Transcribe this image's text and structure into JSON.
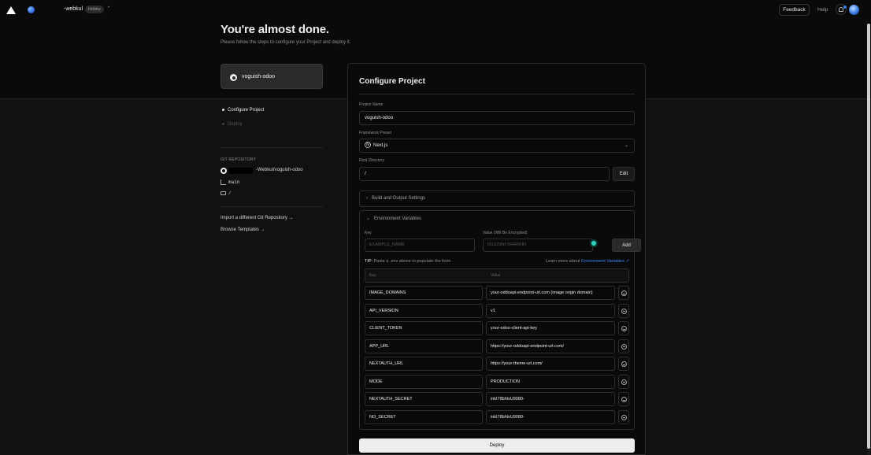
{
  "nav": {
    "team_name": "-webkul",
    "team_plan": "Hobby",
    "feedback_label": "Feedback",
    "help_label": "Help"
  },
  "hero": {
    "title": "You're almost done.",
    "subtitle": "Please follow the steps to configure your Project and deploy it.",
    "repo_card": "voguish-odoo"
  },
  "steps": [
    {
      "label": "Configure Project",
      "active": true
    },
    {
      "label": "Deploy",
      "active": false
    }
  ],
  "git": {
    "section_label": "GIT REPOSITORY",
    "repo": "-Webkul/voguish-odoo",
    "branch": "main",
    "directory": "/"
  },
  "links": {
    "import_repo": "Import a different Git Repository →",
    "browse_templates": "Browse Templates →"
  },
  "configure": {
    "title": "Configure Project",
    "project_name_label": "Project Name",
    "project_name_value": "voguish-odoo",
    "framework_label": "Framework Preset",
    "framework_value": "Next.js",
    "framework_icon": "N",
    "root_dir_label": "Root Directory",
    "root_dir_value": "/",
    "edit_label": "Edit",
    "build_settings_label": "Build and Output Settings",
    "env_section_label": "Environment Variables",
    "key_label": "Key",
    "value_label": "Value (Will Be Encrypted)",
    "key_placeholder": "EXAMPLE_NAME",
    "value_placeholder": "I9JU23NF394R6HH",
    "add_label": "Add",
    "tip_prefix": "TIP:",
    "tip_text": "Paste a .env above to populate the form",
    "learn_more_text": "Learn more about",
    "learn_more_link": "Environment Variables ↗",
    "table_key_header": "Key",
    "table_value_header": "Value",
    "env_vars": [
      {
        "key": "IMAGE_DOMAINS",
        "value": "your-oddoapi-endpoint-url.com (image origin domain)"
      },
      {
        "key": "API_VERSION",
        "value": "v1"
      },
      {
        "key": "CLIENT_TOKEN",
        "value": "your-odoo-client-api-key"
      },
      {
        "key": "APP_URL",
        "value": "https://your-oddoapi-endpoint-url.com/"
      },
      {
        "key": "NEXTAUTH_URL",
        "value": "https://your-theme-url.com/"
      },
      {
        "key": "MODE",
        "value": "PRODUCTION"
      },
      {
        "key": "NEXTAUTH_SECRET",
        "value": "inkI78bhlxU9080-"
      },
      {
        "key": "NO_SECRET",
        "value": "inkI78bhlxU9080-"
      }
    ],
    "deploy_label": "Deploy"
  }
}
